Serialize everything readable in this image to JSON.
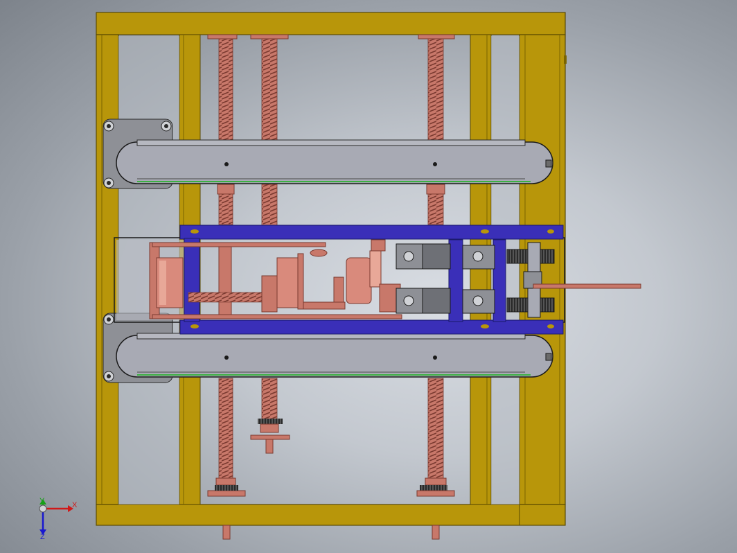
{
  "viewport": {
    "background_center": "#d9dde3",
    "background_edge": "#7d838b"
  },
  "colors": {
    "frame": "#b8960a",
    "frame_dark": "#7a6400",
    "screw": "#c8786a",
    "screw_dark": "#8a4a40",
    "belt": "#a8aab4",
    "belt_outline": "#2a2a2a",
    "carriage": "#3a2fb8",
    "belt_edge": "#3cb043",
    "metal": "#8e9096",
    "black": "#1a1a1a"
  },
  "triad": {
    "x_label": "X",
    "y_label": "Y",
    "z_label": "Z",
    "x_color": "#d01818",
    "y_color": "#18a018",
    "z_color": "#1818d0"
  },
  "icons": {
    "triad": "coordinate-triad-icon"
  }
}
